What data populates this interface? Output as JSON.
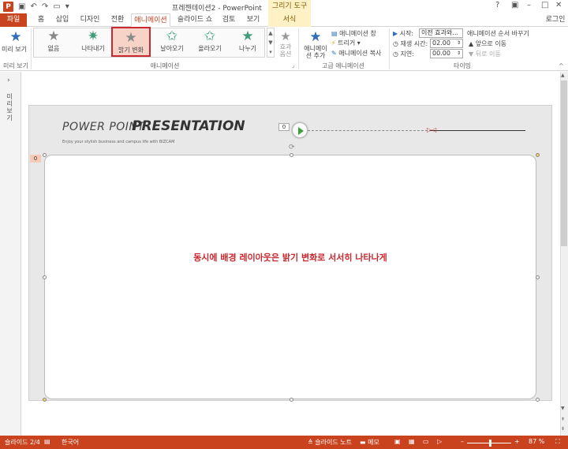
{
  "app": {
    "title": "프레젠테이션2 - PowerPoint",
    "tool_context": "그리기 도구",
    "user": "로그인"
  },
  "tabs": [
    "파일",
    "홈",
    "삽입",
    "디자인",
    "전환",
    "애니메이션",
    "슬라이드 쇼",
    "검토",
    "보기",
    "서식"
  ],
  "ribbon": {
    "preview": {
      "button": "미리 보기",
      "group": "미리 보기"
    },
    "gallery": [
      {
        "label": "없음",
        "color": "#888888"
      },
      {
        "label": "나타내기",
        "color": "#3f9c79"
      },
      {
        "label": "밝기 변화",
        "color": "#8a8a8a"
      },
      {
        "label": "날아오기",
        "color": "#3f9c79"
      },
      {
        "label": "올라오기",
        "color": "#3f9c79"
      },
      {
        "label": "나누기",
        "color": "#3f9c79"
      }
    ],
    "effect_options": "효과 옵션",
    "group_animation": "애니메이션",
    "add_animation": "애니메이션 추가",
    "advanced": {
      "pane": "애니메이션 창",
      "trigger": "트리거",
      "painter": "애니메이션 복사",
      "group": "고급 애니메이션"
    },
    "timing": {
      "start_label": "시작:",
      "start_value": "이전 효과와...",
      "duration_label": "재생 시간:",
      "duration_value": "02.00",
      "delay_label": "지연:",
      "delay_value": "00.00",
      "reorder": "애니메이션 순서 바꾸기",
      "move_earlier": "앞으로 이동",
      "move_later": "뒤로 이동",
      "group": "타이밍"
    }
  },
  "left_pane": {
    "label": "미리보기"
  },
  "slide": {
    "title_light": "POWER POINT",
    "title_bold": "PRESENTATION",
    "subtitle": "Enjoy your stylish business and campus life with BIZCAM",
    "tag_top": "0",
    "tag_zero": "0",
    "main_text": "동시에 배경 레이아웃은 밝기 변화로 서서히 나타나게"
  },
  "status": {
    "slide_counter": "슬라이드 2/4",
    "language": "한국어",
    "notes": "슬라이드 노트",
    "comments": "메모",
    "zoom": "87 %"
  },
  "colors": {
    "accent": "#c9431e",
    "selection": "#c8282e"
  }
}
